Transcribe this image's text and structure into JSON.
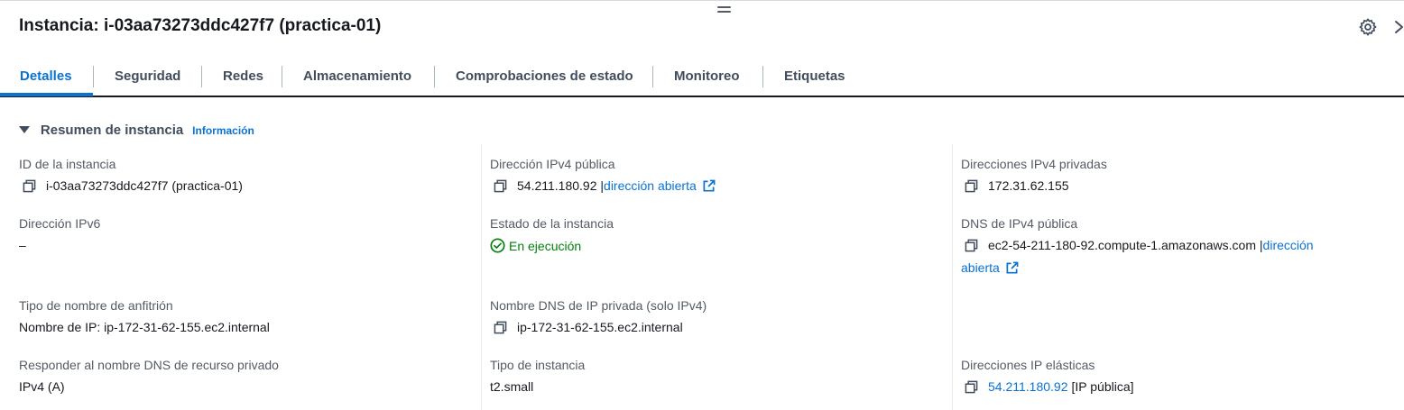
{
  "header": {
    "title": "Instancia: i-03aa73273ddc427f7 (practica-01)"
  },
  "tabs": [
    {
      "label": "Detalles",
      "active": true
    },
    {
      "label": "Seguridad",
      "active": false
    },
    {
      "label": "Redes",
      "active": false
    },
    {
      "label": "Almacenamiento",
      "active": false
    },
    {
      "label": "Comprobaciones de estado",
      "active": false
    },
    {
      "label": "Monitoreo",
      "active": false
    },
    {
      "label": "Etiquetas",
      "active": false
    }
  ],
  "summary": {
    "title": "Resumen de instancia",
    "info": "Información"
  },
  "fields": {
    "instance_id": {
      "label": "ID de la instancia",
      "value": "i-03aa73273ddc427f7 (practica-01)"
    },
    "public_ipv4": {
      "label": "Dirección IPv4 pública",
      "value": "54.211.180.92 |",
      "link": "dirección abierta"
    },
    "private_ipv4": {
      "label": "Direcciones IPv4 privadas",
      "value": "172.31.62.155"
    },
    "ipv6": {
      "label": "Dirección IPv6",
      "value": "–"
    },
    "instance_state": {
      "label": "Estado de la instancia",
      "value": "En ejecución"
    },
    "public_dns": {
      "label": "DNS de IPv4 pública",
      "value": "ec2-54-211-180-92.compute-1.amazonaws.com |",
      "link_part1": "dirección",
      "link_part2": "abierta"
    },
    "hostname_type": {
      "label": "Tipo de nombre de anfitrión",
      "value": "Nombre de IP: ip-172-31-62-155.ec2.internal"
    },
    "private_dns": {
      "label": "Nombre DNS de IP privada (solo IPv4)",
      "value": "ip-172-31-62-155.ec2.internal"
    },
    "resource_dns": {
      "label": "Responder al nombre DNS de recurso privado",
      "value": "IPv4 (A)"
    },
    "instance_type": {
      "label": "Tipo de instancia",
      "value": "t2.small"
    },
    "elastic_ip": {
      "label": "Direcciones IP elásticas",
      "link": "54.211.180.92",
      "suffix": "[IP pública]"
    }
  },
  "colors": {
    "accent": "#0972d3",
    "success": "#037f0c",
    "text": "#16191f",
    "label": "#545b64"
  }
}
